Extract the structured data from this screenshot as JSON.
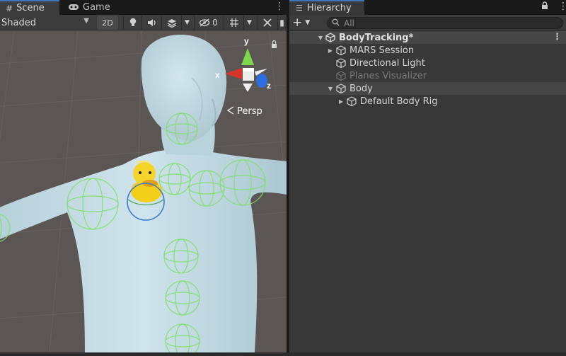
{
  "scene_window": {
    "tabs": [
      {
        "label": "Scene",
        "icon": "grid-icon",
        "active": true
      },
      {
        "label": "Game",
        "icon": "gamepad-icon",
        "active": false
      }
    ],
    "toolbar": {
      "shading_mode": "Shaded",
      "two_d_label": "2D",
      "hidden_count": "0"
    },
    "gizmo": {
      "axis_y": "y",
      "axis_x": "x",
      "axis_z": "z",
      "projection_label": "Persp"
    }
  },
  "hierarchy_window": {
    "tab_label": "Hierarchy",
    "add_label": "+",
    "search": {
      "placeholder": "All"
    },
    "scene_name": "BodyTracking*",
    "items": [
      {
        "label": "MARS Session",
        "depth": 1,
        "foldout": "collapsed",
        "active": true,
        "selected": false
      },
      {
        "label": "Directional Light",
        "depth": 1,
        "foldout": "none",
        "active": true,
        "selected": false
      },
      {
        "label": "Planes Visualizer",
        "depth": 1,
        "foldout": "none",
        "active": false,
        "selected": false
      },
      {
        "label": "Body",
        "depth": 1,
        "foldout": "expanded",
        "active": true,
        "selected": true
      },
      {
        "label": "Default Body Rig",
        "depth": 2,
        "foldout": "collapsed",
        "active": true,
        "selected": false
      }
    ]
  },
  "colors": {
    "accent_tab": "#3a79bb",
    "scene_background": "#5b5653",
    "body_fill": "#c5dde6",
    "joint_green": "#7fe06a",
    "selected_joint": "#3d7ccf",
    "duck_yellow": "#f3cf19",
    "gizmo_x": "#d8322a",
    "gizmo_y": "#7bd84a",
    "gizmo_z": "#2d6fe0"
  }
}
